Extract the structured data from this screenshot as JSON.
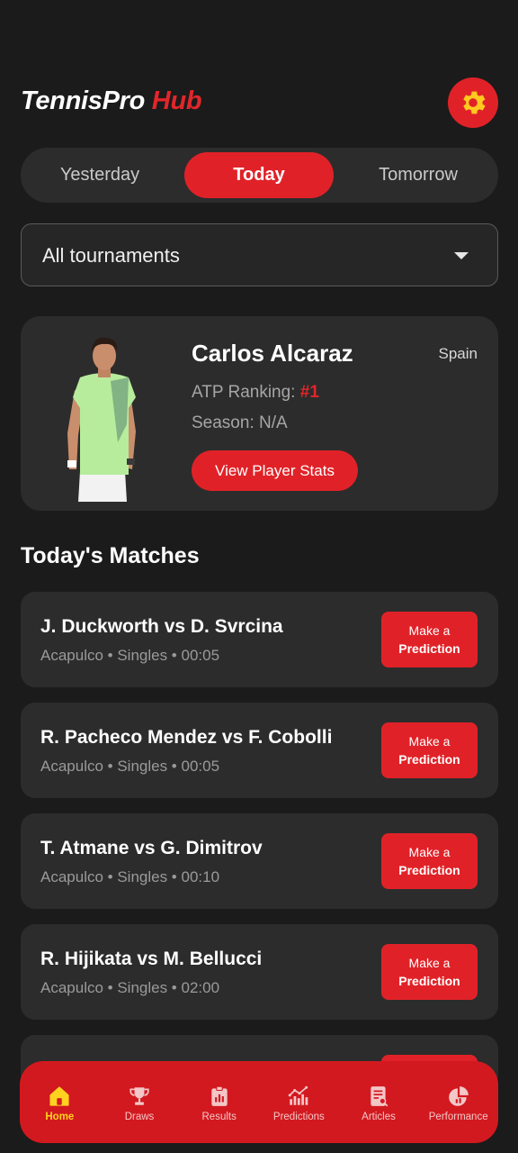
{
  "brand": {
    "name": "TennisPro",
    "accent": "Hub"
  },
  "header": {
    "settings_icon": "gear-icon"
  },
  "day_tabs": [
    {
      "label": "Yesterday",
      "active": false
    },
    {
      "label": "Today",
      "active": true
    },
    {
      "label": "Tomorrow",
      "active": false
    }
  ],
  "tournament_filter": {
    "selected": "All tournaments"
  },
  "player": {
    "name": "Carlos Alcaraz",
    "country": "Spain",
    "ranking_label": "ATP Ranking:",
    "ranking_value": "#1",
    "season": "Season: N/A",
    "stats_button": "View Player Stats"
  },
  "matches_section": {
    "title": "Today's Matches"
  },
  "matches": [
    {
      "title": "J. Duckworth vs D. Svrcina",
      "meta": "Acapulco • Singles • 00:05",
      "button_line1": "Make a",
      "button_line2": "Prediction"
    },
    {
      "title": "R. Pacheco Mendez vs F. Cobolli",
      "meta": "Acapulco • Singles • 00:05",
      "button_line1": "Make a",
      "button_line2": "Prediction"
    },
    {
      "title": "T. Atmane vs G. Dimitrov",
      "meta": "Acapulco • Singles • 00:10",
      "button_line1": "Make a",
      "button_line2": "Prediction"
    },
    {
      "title": "R. Hijikata vs M. Bellucci",
      "meta": "Acapulco • Singles • 02:00",
      "button_line1": "Make a",
      "button_line2": "Prediction"
    }
  ],
  "bottom_nav": [
    {
      "label": "Home",
      "icon": "home-icon",
      "active": true
    },
    {
      "label": "Draws",
      "icon": "trophy-icon",
      "active": false
    },
    {
      "label": "Results",
      "icon": "clipboard-chart-icon",
      "active": false
    },
    {
      "label": "Predictions",
      "icon": "trend-chart-icon",
      "active": false
    },
    {
      "label": "Articles",
      "icon": "article-icon",
      "active": false
    },
    {
      "label": "Performance",
      "icon": "pie-chart-icon",
      "active": false
    }
  ],
  "colors": {
    "accent": "#e02228",
    "background": "#1b1b1b",
    "card": "#2c2c2c",
    "nav_active": "#ffd21f"
  }
}
